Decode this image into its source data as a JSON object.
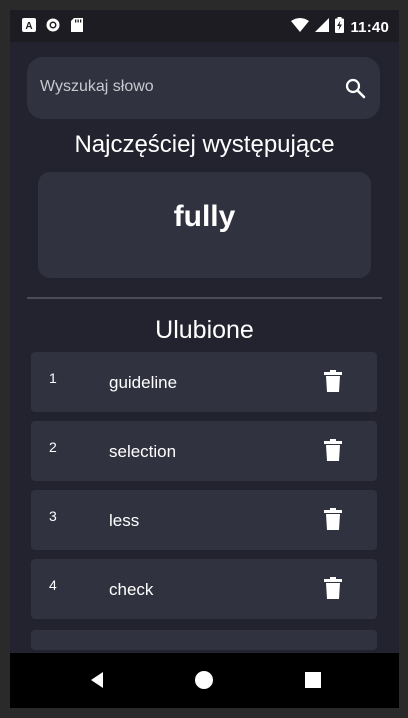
{
  "statusbar": {
    "time": "11:40",
    "icons_left": [
      "font-app-icon",
      "circle-app-icon",
      "sd-card-icon"
    ],
    "icons_right": [
      "wifi-icon",
      "signal-icon",
      "battery-charging-icon"
    ]
  },
  "search": {
    "placeholder": "Wyszukaj słowo",
    "icon": "search-icon"
  },
  "most_frequent": {
    "title": "Najczęściej występujące",
    "word": "fully"
  },
  "favorites": {
    "title": "Ulubione",
    "items": [
      {
        "number": "1",
        "word": "guideline"
      },
      {
        "number": "2",
        "word": "selection"
      },
      {
        "number": "3",
        "word": "less"
      },
      {
        "number": "4",
        "word": "check"
      }
    ],
    "delete_icon": "trash-icon"
  },
  "navbar": {
    "buttons": [
      "back-icon",
      "home-icon",
      "recents-icon"
    ]
  },
  "colors": {
    "background": "#23232f",
    "card": "#30323f",
    "text": "#ffffff"
  }
}
